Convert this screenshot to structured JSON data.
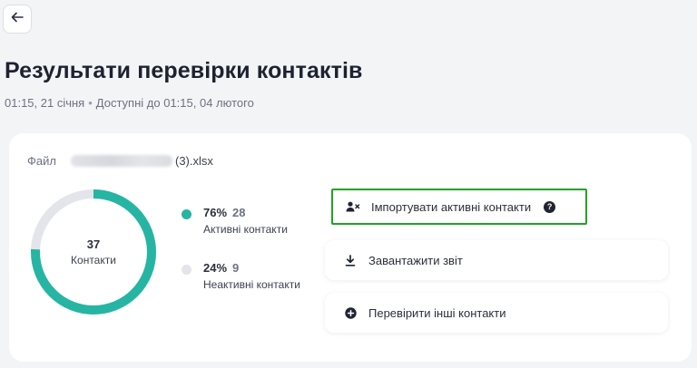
{
  "header": {
    "title": "Результати перевірки контактів",
    "created": "01:15, 21 січня",
    "separator": "•",
    "available": "Доступні до 01:15, 04 лютого"
  },
  "file": {
    "label": "Файл",
    "name_suffix": "(3).xlsx"
  },
  "summary": {
    "total": "37",
    "total_label": "Контакти",
    "active_fraction": 0.757,
    "active": {
      "percent": "76%",
      "count": "28",
      "label": "Активні контакти"
    },
    "inactive": {
      "percent": "24%",
      "count": "9",
      "label": "Неактивні контакти"
    }
  },
  "actions": {
    "import_label": "Імпортувати активні контакти",
    "help_glyph": "?",
    "download_label": "Завантажити звіт",
    "check_other_label": "Перевірити інші контакти"
  },
  "colors": {
    "active": "#26b5a3",
    "inactive": "#e3e5ea",
    "highlight_border": "#22a322"
  },
  "icons": {
    "back": "arrow-left-icon",
    "import": "user-remove-icon",
    "help": "question-circle-icon",
    "download": "download-icon",
    "check_other": "plus-circle-icon"
  }
}
